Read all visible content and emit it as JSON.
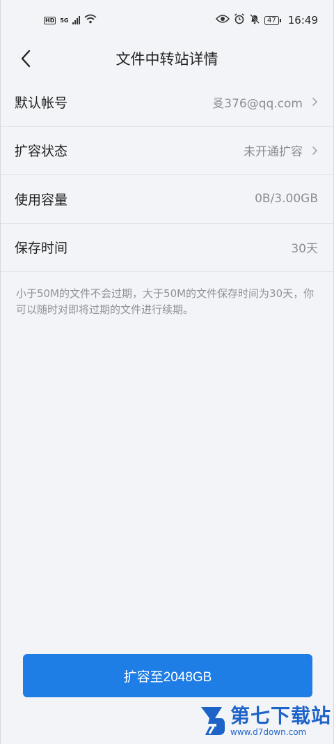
{
  "status_bar": {
    "hd": "HD",
    "net": "5G",
    "battery": "47",
    "time": "16:49"
  },
  "header": {
    "title": "文件中转站详情"
  },
  "rows": [
    {
      "label": "默认帐号",
      "value": "㕛376@qq.com"
    },
    {
      "label": "扩容状态",
      "value": "未开通扩容"
    },
    {
      "label": "使用容量",
      "value": "0B/3.00GB"
    },
    {
      "label": "保存时间",
      "value": "30天"
    }
  ],
  "note": "小于50M的文件不会过期，大于50M的文件保存时间为30天，你可以随时对即将过期的文件进行续期。",
  "button": {
    "label": "扩容至2048GB"
  },
  "watermark": {
    "title": "第七下载站",
    "url": "www.d7down.com"
  },
  "colors": {
    "accent": "#1f7ee6",
    "background": "#f3f4f7",
    "watermark": "#1e63c8"
  },
  "icons": [
    "back-arrow-icon",
    "chevron-right-icon",
    "eye-icon",
    "alarm-icon",
    "bell-mute-icon",
    "wifi-icon",
    "signal-icon",
    "battery-icon"
  ]
}
